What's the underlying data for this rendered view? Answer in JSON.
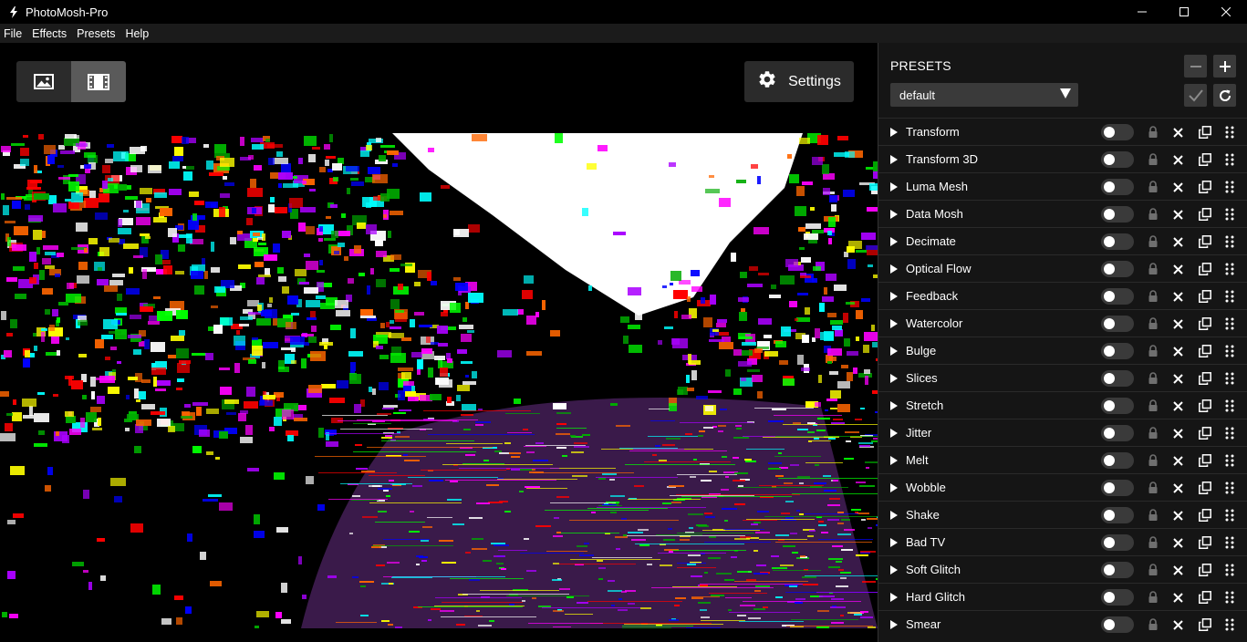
{
  "window": {
    "title": "PhotoMosh-Pro"
  },
  "menu": [
    "File",
    "Effects",
    "Presets",
    "Help"
  ],
  "toolbar": {
    "settings_label": "Settings"
  },
  "presets": {
    "title": "PRESETS",
    "selected": "default"
  },
  "effects": [
    "Transform",
    "Transform 3D",
    "Luma Mesh",
    "Data Mosh",
    "Decimate",
    "Optical Flow",
    "Feedback",
    "Watercolor",
    "Bulge",
    "Slices",
    "Stretch",
    "Jitter",
    "Melt",
    "Wobble",
    "Shake",
    "Bad TV",
    "Soft Glitch",
    "Hard Glitch",
    "Smear"
  ],
  "colors": {
    "panel_bg": "#151515",
    "button_bg": "#2b2b2b",
    "active_bg": "#5a5a5a"
  }
}
